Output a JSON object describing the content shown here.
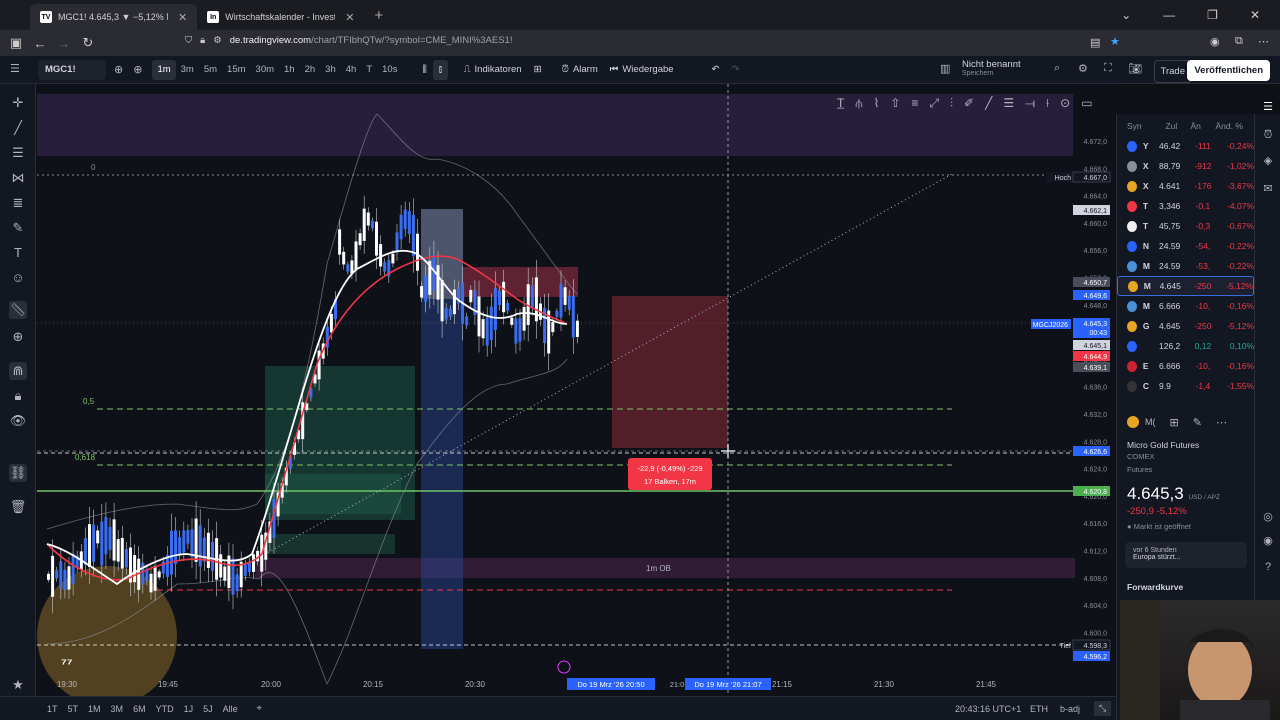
{
  "browser": {
    "tabs": [
      {
        "title": "MGC1! 4.645,3 ▼ −5,12% Nicht",
        "active": true
      },
      {
        "title": "Wirtschaftskalender - Investing",
        "active": false
      }
    ],
    "url_domain": "de.tradingview.com",
    "url_path": "/chart/TFIbhQTw/?symbol=CME_MINI%3AES1!"
  },
  "toolbar": {
    "symbol": "MGC1!",
    "timeframes": [
      "1m",
      "3m",
      "5m",
      "15m",
      "30m",
      "1h",
      "2h",
      "3h",
      "4h",
      "T",
      "10s"
    ],
    "active_timeframe": "1m",
    "indicators_label": "Indikatoren",
    "alarm_label": "Alarm",
    "replay_label": "Wiedergabe",
    "layout_name": "Nicht benannt",
    "layout_sub": "Speichern",
    "trade_label": "Trade",
    "publish_label": "Veröffentlichen"
  },
  "chart": {
    "price_axis": [
      "4.672,0",
      "4.668,0",
      "4.664,0",
      "4.660,0",
      "4.656,0",
      "4.652,0",
      "4.648,0",
      "4.644,0",
      "4.640,0",
      "4.636,0",
      "4.632,0",
      "4.628,0",
      "4.624,0",
      "4.620,0",
      "4.616,0",
      "4.612,0",
      "4.608,0",
      "4.604,0",
      "4.600,0"
    ],
    "time_axis": [
      "19:30",
      "19:45",
      "20:00",
      "20:15",
      "20:30",
      "21:15",
      "21:30",
      "21:45"
    ],
    "price_labels": {
      "hoch_label": "Hoch",
      "hoch": "4.667,0",
      "p1": "4.662,1",
      "p2": "4.650,7",
      "p3": "4.649,6",
      "symbol_tag": "MGCJ2026",
      "current": "4.645,3",
      "countdown": "00:43",
      "p4": "4.645,1",
      "p5": "4.644,9",
      "p6": "4.639,1",
      "p7": "4.626,6",
      "p8": "4.620,8",
      "tief_label": "Tief",
      "tief1": "4.598,3",
      "tief2": "4.596,2"
    },
    "fib_labels": {
      "zero": "0",
      "half": "0,5",
      "golden": "0,618"
    },
    "ob_label": "1m OB",
    "measure": {
      "line1": "-22,9 (-0,49%) -229",
      "line2": "17 Balken, 17m"
    },
    "date_start": "Do 19 Mrz '26  20:50",
    "date_end": "Do 19 Mrz '26  21:07",
    "time_under_end": "21:0"
  },
  "bottombar": {
    "ranges": [
      "1T",
      "5T",
      "1M",
      "3M",
      "6M",
      "YTD",
      "1J",
      "5J",
      "Alle"
    ],
    "clock": "20:43:16 UTC+1",
    "session": "ETH",
    "adj": "b-adj"
  },
  "watchlist": {
    "headers": [
      "Syn",
      "Zul",
      "Än",
      "Änd. %"
    ],
    "rows": [
      {
        "s": "Y",
        "last": "46.42",
        "chg": "-111",
        "pct": "-0,24%",
        "color": "#2962ff"
      },
      {
        "s": "X",
        "last": "88,79",
        "chg": "-912",
        "pct": "-1,02%",
        "color": "#8a8e99"
      },
      {
        "s": "X",
        "last": "4.641",
        "chg": "-176",
        "pct": "-3,67%",
        "color": "#e6a623"
      },
      {
        "s": "T",
        "last": "3,346",
        "chg": "-0,1",
        "pct": "-4,07%",
        "color": "#f23645"
      },
      {
        "s": "T",
        "last": "45,75",
        "chg": "-0,3",
        "pct": "-0,67%",
        "color": "#eeeeee"
      },
      {
        "s": "N",
        "last": "24.59",
        "chg": "-54,",
        "pct": "-0,22%",
        "color": "#2962ff"
      },
      {
        "s": "M",
        "last": "24.59",
        "chg": "-53,",
        "pct": "-0,22%",
        "color": "#4a90d9"
      },
      {
        "s": "M",
        "last": "4.645",
        "chg": "-250",
        "pct": "-5,12%",
        "color": "#e6a623",
        "sel": true
      },
      {
        "s": "M",
        "last": "6.666",
        "chg": "-10,",
        "pct": "-0,16%",
        "color": "#4a90d9"
      },
      {
        "s": "G",
        "last": "4.645",
        "chg": "-250",
        "pct": "-5,12%",
        "color": "#e6a623"
      },
      {
        "s": "",
        "last": "126,2",
        "chg": "0,12",
        "pct": "0,10%",
        "color": "#2962ff",
        "pos": true
      },
      {
        "s": "E",
        "last": "6.666",
        "chg": "-10,",
        "pct": "-0,16%",
        "color": "#cc2233"
      },
      {
        "s": "C",
        "last": "9.9",
        "chg": "-1,4",
        "pct": "-1,55%",
        "color": "#333"
      }
    ]
  },
  "detail": {
    "short": "M(",
    "name": "Micro Gold Futures",
    "exchange": "COMEX",
    "type": "Futures",
    "price": "4.645,3",
    "currency": "USD / APZ",
    "change": "-250,9  -5,12%",
    "market": "Markt ist geöffnet",
    "news_line1": "vor 6 Stunden",
    "news_line2": "Europa stürzt...",
    "forward": "Forwardkurve"
  },
  "colors": {
    "up": "#3a6df0",
    "down": "#ffffff",
    "ema_fast": "#ffffff",
    "ema_slow": "#f23645",
    "accent": "#2962ff"
  }
}
